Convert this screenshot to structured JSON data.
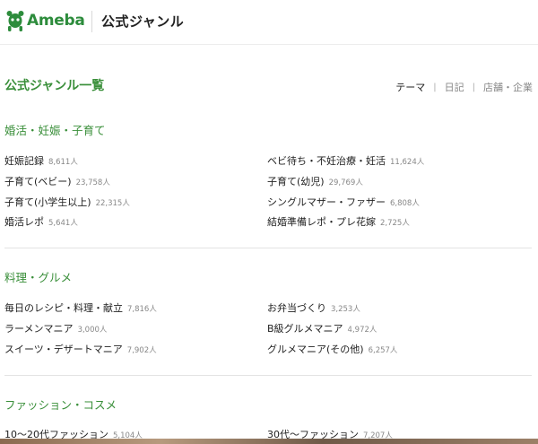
{
  "header": {
    "logo_text": "Ameba",
    "title": "公式ジャンル",
    "brand_color": "#2d8c3c"
  },
  "main": {
    "title": "公式ジャンル一覧",
    "tabs": [
      {
        "label": "テーマ",
        "active": true
      },
      {
        "label": "日記",
        "active": false
      },
      {
        "label": "店舗・企業",
        "active": false
      }
    ],
    "tab_separator": "|"
  },
  "sections": [
    {
      "title": "婚活・妊娠・子育て",
      "items": [
        {
          "label": "妊娠記録",
          "count": "8,611人"
        },
        {
          "label": "ベビ待ち・不妊治療・妊活",
          "count": "11,624人"
        },
        {
          "label": "子育て(ベビー)",
          "count": "23,758人"
        },
        {
          "label": "子育て(幼児)",
          "count": "29,769人"
        },
        {
          "label": "子育て(小学生以上)",
          "count": "22,315人"
        },
        {
          "label": "シングルマザー・ファザー",
          "count": "6,808人"
        },
        {
          "label": "婚活レポ",
          "count": "5,641人"
        },
        {
          "label": "結婚準備レポ・プレ花嫁",
          "count": "2,725人"
        }
      ]
    },
    {
      "title": "料理・グルメ",
      "items": [
        {
          "label": "毎日のレシピ・料理・献立",
          "count": "7,816人"
        },
        {
          "label": "お弁当づくり",
          "count": "3,253人"
        },
        {
          "label": "ラーメンマニア",
          "count": "3,000人"
        },
        {
          "label": "B級グルメマニア",
          "count": "4,972人"
        },
        {
          "label": "スイーツ・デザートマニア",
          "count": "7,902人"
        },
        {
          "label": "グルメマニア(その他)",
          "count": "6,257人"
        }
      ]
    },
    {
      "title": "ファッション・コスメ",
      "items": [
        {
          "label": "10～20代ファッション",
          "count": "5,104人"
        },
        {
          "label": "30代～ファッション",
          "count": "7,207人"
        }
      ]
    }
  ]
}
